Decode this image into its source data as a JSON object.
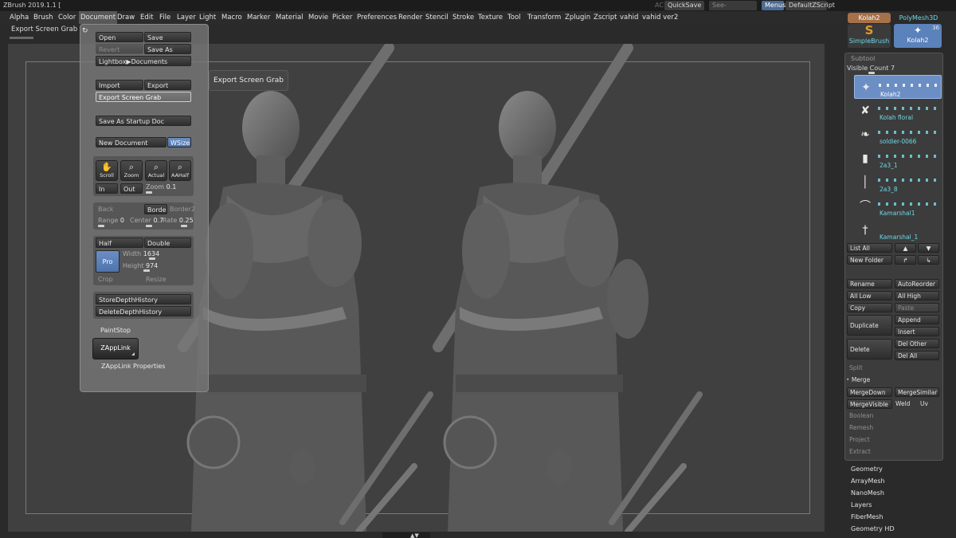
{
  "app_title": "ZBrush 2019.1.1 [",
  "titlebar": {
    "ac_label": "AC",
    "quicksave": "QuickSave",
    "see_through_label": "See-through",
    "see_through_value": "0",
    "menus": "Menus",
    "default_zscript": "DefaultZScript"
  },
  "menubar": [
    "Alpha",
    "Brush",
    "Color",
    "Document",
    "Draw",
    "Edit",
    "File",
    "Layer",
    "Light",
    "Macro",
    "Marker",
    "Material",
    "Movie",
    "Picker",
    "Preferences",
    "Render",
    "Stencil",
    "Stroke",
    "Texture",
    "Tool",
    "Transform",
    "Zplugin",
    "Zscript",
    "vahid",
    "vahid ver2"
  ],
  "status_text": "Export Screen Grab",
  "document_panel": {
    "open": "Open",
    "save": "Save",
    "revert": "Revert",
    "save_as": "Save As",
    "lightbox": "Lightbox▶Documents",
    "import": "Import",
    "export": "Export",
    "export_screen_grab": "Export Screen Grab",
    "save_startup": "Save As Startup Doc",
    "new_document": "New Document",
    "wsize": "WSize",
    "scroll": "Scroll",
    "zoom": "Zoom",
    "actual": "Actual",
    "aahalf": "AAHalf",
    "in": "In",
    "out": "Out",
    "zoom_label": "Zoom",
    "zoom_value": "0.1",
    "back": "Back",
    "border": "Border",
    "border2": "Border2",
    "range_label": "Range",
    "range_value": "0",
    "center_label": "Center",
    "center_value": "0.7",
    "rate_label": "Rate",
    "rate_value": "0.25",
    "half": "Half",
    "double": "Double",
    "pro": "Pro",
    "width_label": "Width",
    "width_value": "1634",
    "height_label": "Height",
    "height_value": "974",
    "crop": "Crop",
    "resize": "Resize",
    "store_depth": "StoreDepthHistory",
    "delete_depth": "DeleteDepthHistory",
    "paintstop": "PaintStop",
    "zapplink": "ZAppLink",
    "zapplink_props": "ZAppLink Properties"
  },
  "tooltip": "Export Screen Grab",
  "tool_thumbs": {
    "top_left": "Kolah2",
    "top_right": "PolyMesh3D",
    "brush": "SimpleBrush",
    "brush_icon": "S",
    "current": "Kolah2",
    "current_count": "36"
  },
  "subtool": {
    "title": "Subtool",
    "visible_count_label": "Visible Count",
    "visible_count_value": "7",
    "items": [
      {
        "name": "Kolah2",
        "icon": "✦"
      },
      {
        "name": "Kolah floral",
        "icon": "✘"
      },
      {
        "name": "soldier-0066",
        "icon": "❧"
      },
      {
        "name": "2a3_1",
        "icon": "▮"
      },
      {
        "name": "2a3_8",
        "icon": "│"
      },
      {
        "name": "Kamarshal1",
        "icon": "⌒"
      },
      {
        "name": "Kamarshal_1",
        "icon": "†"
      }
    ],
    "list_all": "List All",
    "new_folder": "New Folder",
    "rename": "Rename",
    "auto_reorder": "AutoReorder",
    "all_low": "All Low",
    "all_high": "All High",
    "copy": "Copy",
    "paste": "Paste",
    "duplicate": "Duplicate",
    "append": "Append",
    "insert": "Insert",
    "delete": "Delete",
    "del_other": "Del Other",
    "del_all": "Del All",
    "split": "Split",
    "merge": "Merge",
    "merge_down": "MergeDown",
    "merge_similar": "MergeSimilar",
    "merge_visible": "MergeVisible",
    "weld": "Weld",
    "uv": "Uv",
    "boolean": "Boolean",
    "remesh": "Remesh",
    "project": "Project",
    "extract": "Extract"
  },
  "tool_sections": [
    "Geometry",
    "ArrayMesh",
    "NanoMesh",
    "Layers",
    "FiberMesh",
    "Geometry HD"
  ]
}
